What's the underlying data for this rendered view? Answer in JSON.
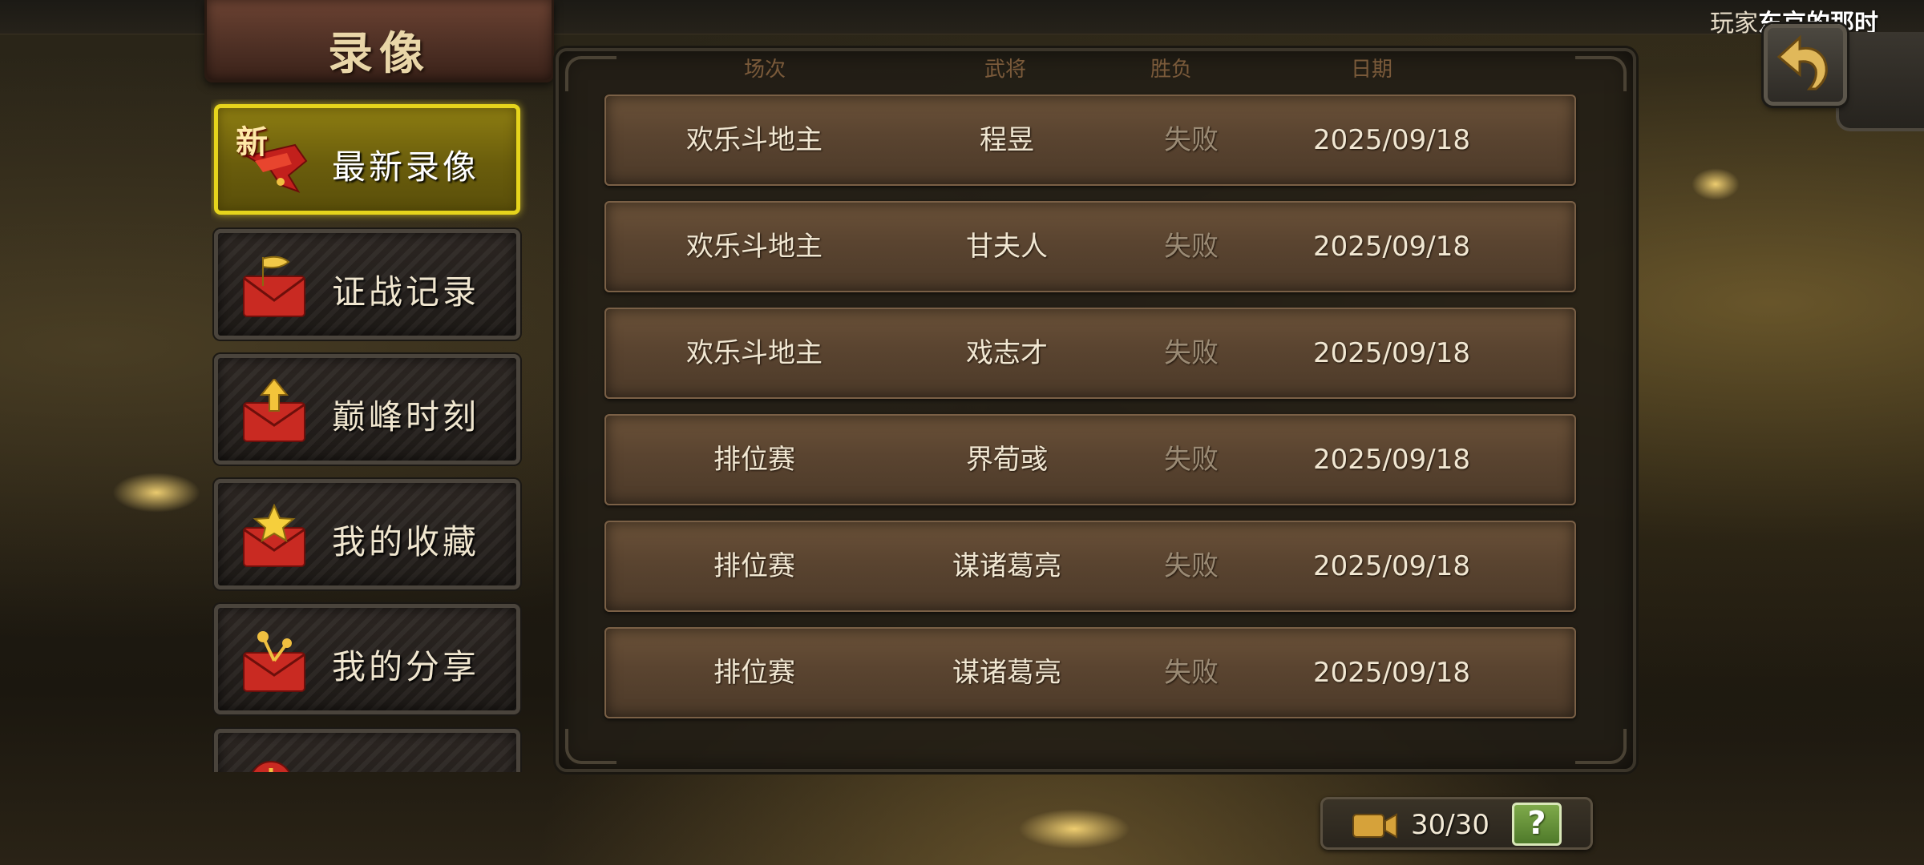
{
  "header": {
    "player_prefix": "玩家",
    "player_name": "东京的那时"
  },
  "title": "录像",
  "sidebar": {
    "items": [
      {
        "label": "最新录像",
        "badge": "新",
        "icon": "new-ribbon-icon",
        "active": true
      },
      {
        "label": "证战记录",
        "icon": "flag-envelope-icon",
        "active": false
      },
      {
        "label": "巅峰时刻",
        "icon": "arrow-up-envelope-icon",
        "active": false
      },
      {
        "label": "我的收藏",
        "icon": "star-envelope-icon",
        "active": false
      },
      {
        "label": "我的分享",
        "icon": "share-envelope-icon",
        "active": false
      },
      {
        "label": "",
        "icon": "partial-envelope-icon",
        "active": false
      }
    ]
  },
  "table": {
    "columns": [
      "场次",
      "武将",
      "胜负",
      "日期"
    ],
    "rows": [
      {
        "mode": "欢乐斗地主",
        "general": "程昱",
        "result": "失败",
        "date": "2025/09/18"
      },
      {
        "mode": "欢乐斗地主",
        "general": "甘夫人",
        "result": "失败",
        "date": "2025/09/18"
      },
      {
        "mode": "欢乐斗地主",
        "general": "戏志才",
        "result": "失败",
        "date": "2025/09/18"
      },
      {
        "mode": "排位赛",
        "general": "界荀彧",
        "result": "失败",
        "date": "2025/09/18"
      },
      {
        "mode": "排位赛",
        "general": "谋诸葛亮",
        "result": "失败",
        "date": "2025/09/18"
      },
      {
        "mode": "排位赛",
        "general": "谋诸葛亮",
        "result": "失败",
        "date": "2025/09/18"
      }
    ]
  },
  "footer": {
    "counter": "30/30",
    "help_label": "?",
    "video_icon": "video-camera-icon"
  },
  "colors": {
    "active_border": "#e6d41c",
    "row_bg": "#5a4430",
    "result_lose": "#9a8a74",
    "help_green": "#5f8a36"
  }
}
